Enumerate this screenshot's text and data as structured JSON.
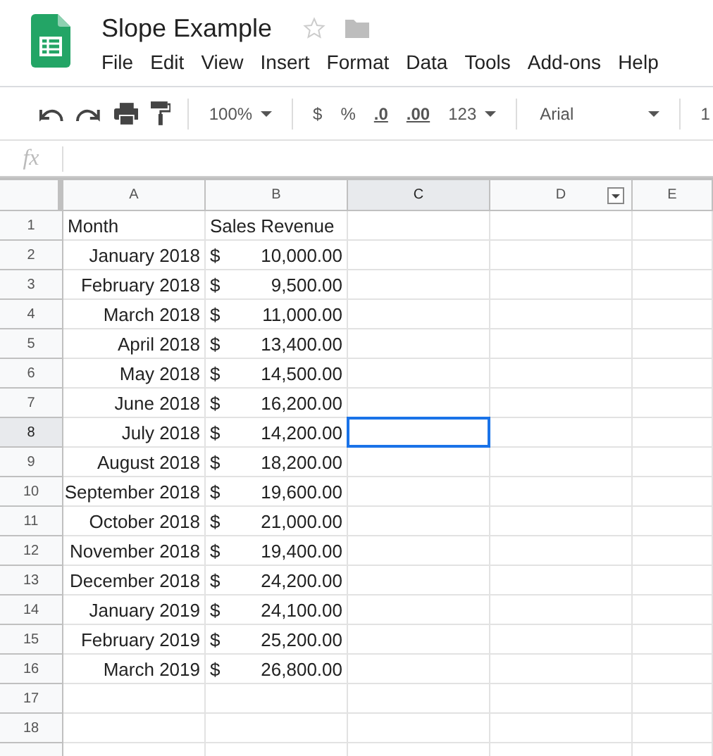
{
  "document": {
    "title": "Slope Example"
  },
  "menu": [
    "File",
    "Edit",
    "View",
    "Insert",
    "Format",
    "Data",
    "Tools",
    "Add-ons",
    "Help"
  ],
  "toolbar": {
    "zoom": "100%",
    "currency": "$",
    "percent": "%",
    "decrease_decimals": ".0",
    "increase_decimals": ".00",
    "number_format": "123",
    "font": "Arial",
    "font_size": "1"
  },
  "formula_bar": {
    "label": "fx"
  },
  "columns": [
    {
      "label": "A",
      "selected": false
    },
    {
      "label": "B",
      "selected": false
    },
    {
      "label": "C",
      "selected": true
    },
    {
      "label": "D",
      "selected": false,
      "filter": true
    },
    {
      "label": "E",
      "selected": false
    }
  ],
  "rows": [
    {
      "number": "1",
      "selected": false,
      "kind": "header",
      "month": "Month",
      "revenue_label": "Sales Revenue"
    },
    {
      "number": "2",
      "selected": false,
      "kind": "data",
      "month": "January 2018",
      "currency": "$",
      "amount": "10,000.00"
    },
    {
      "number": "3",
      "selected": false,
      "kind": "data",
      "month": "February 2018",
      "currency": "$",
      "amount": "9,500.00"
    },
    {
      "number": "4",
      "selected": false,
      "kind": "data",
      "month": "March 2018",
      "currency": "$",
      "amount": "11,000.00"
    },
    {
      "number": "5",
      "selected": false,
      "kind": "data",
      "month": "April 2018",
      "currency": "$",
      "amount": "13,400.00"
    },
    {
      "number": "6",
      "selected": false,
      "kind": "data",
      "month": "May 2018",
      "currency": "$",
      "amount": "14,500.00"
    },
    {
      "number": "7",
      "selected": false,
      "kind": "data",
      "month": "June 2018",
      "currency": "$",
      "amount": "16,200.00"
    },
    {
      "number": "8",
      "selected": true,
      "kind": "data",
      "month": "July 2018",
      "currency": "$",
      "amount": "14,200.00"
    },
    {
      "number": "9",
      "selected": false,
      "kind": "data",
      "month": "August 2018",
      "currency": "$",
      "amount": "18,200.00"
    },
    {
      "number": "10",
      "selected": false,
      "kind": "data",
      "month": "September 2018",
      "currency": "$",
      "amount": "19,600.00"
    },
    {
      "number": "11",
      "selected": false,
      "kind": "data",
      "month": "October 2018",
      "currency": "$",
      "amount": "21,000.00"
    },
    {
      "number": "12",
      "selected": false,
      "kind": "data",
      "month": "November 2018",
      "currency": "$",
      "amount": "19,400.00"
    },
    {
      "number": "13",
      "selected": false,
      "kind": "data",
      "month": "December 2018",
      "currency": "$",
      "amount": "24,200.00"
    },
    {
      "number": "14",
      "selected": false,
      "kind": "data",
      "month": "January 2019",
      "currency": "$",
      "amount": "24,100.00"
    },
    {
      "number": "15",
      "selected": false,
      "kind": "data",
      "month": "February 2019",
      "currency": "$",
      "amount": "25,200.00"
    },
    {
      "number": "16",
      "selected": false,
      "kind": "data",
      "month": "March 2019",
      "currency": "$",
      "amount": "26,800.00"
    },
    {
      "number": "17",
      "selected": false,
      "kind": "empty"
    },
    {
      "number": "18",
      "selected": false,
      "kind": "empty"
    }
  ]
}
